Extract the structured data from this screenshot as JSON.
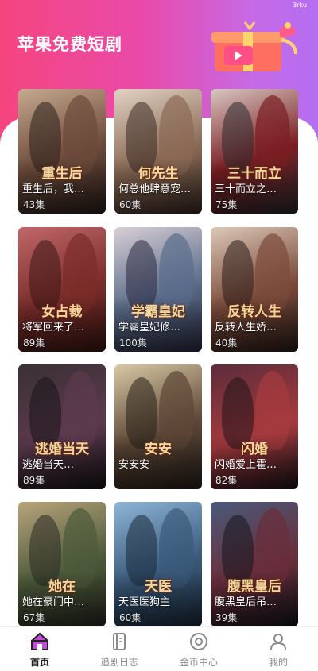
{
  "status": {
    "tag": "3rku"
  },
  "header": {
    "title": "苹果免费短剧"
  },
  "dramas": [
    {
      "deco": "重生后",
      "title": "重生后，我…",
      "episodes": "43集",
      "colors": [
        "#c7a98f",
        "#6b4a3a",
        "#2b1f1c"
      ]
    },
    {
      "deco": "何先生",
      "title": "何总他肆意宠…",
      "episodes": "60集",
      "colors": [
        "#e2d3c4",
        "#8a6a55",
        "#3a2a24"
      ]
    },
    {
      "deco": "三十而立",
      "title": "三十而立之…",
      "episodes": "75集",
      "colors": [
        "#d8c7c2",
        "#7a1e22",
        "#2c2a2e"
      ]
    },
    {
      "deco": "女占裁",
      "title": "将军回来了…",
      "episodes": "89集",
      "colors": [
        "#c0676a",
        "#7a2c2a",
        "#3b1814"
      ]
    },
    {
      "deco": "学霸皇妃",
      "title": "学霸皇妃修…",
      "episodes": "100集",
      "colors": [
        "#d9cfd6",
        "#5a6c8a",
        "#2a2a40"
      ]
    },
    {
      "deco": "反转人生",
      "title": "反转人生娇…",
      "episodes": "40集",
      "colors": [
        "#dcc8b8",
        "#7a4a3a",
        "#2c1e1a"
      ]
    },
    {
      "deco": "逃婚当天",
      "title": "逃婚当天…",
      "episodes": "89集",
      "colors": [
        "#3a3034",
        "#5c3a4e",
        "#1a1418"
      ]
    },
    {
      "deco": "安安",
      "title": "安安安",
      "episodes": "",
      "colors": [
        "#d9c9a4",
        "#5c4636",
        "#28201a"
      ]
    },
    {
      "deco": "闪婚",
      "title": "闪婚爱上霍…",
      "episodes": "82集",
      "colors": [
        "#5b2c3a",
        "#a53a3e",
        "#20141a"
      ]
    },
    {
      "deco": "她在",
      "title": "她在豪门中…",
      "episodes": "67集",
      "colors": [
        "#b8a47c",
        "#4c5a3a",
        "#2a2a22"
      ]
    },
    {
      "deco": "天医",
      "title": "天医医狗主",
      "episodes": "60集",
      "colors": [
        "#8fb5d6",
        "#3a5a7a",
        "#1a2a3a"
      ]
    },
    {
      "deco": "腹黑皇后",
      "title": "腹黑皇后吊…",
      "episodes": "39集",
      "colors": [
        "#4a5a7a",
        "#6a2e3a",
        "#14161e"
      ]
    }
  ],
  "tabs": [
    {
      "label": "首页",
      "icon": "home-icon",
      "active": true
    },
    {
      "label": "追剧日志",
      "icon": "book-icon",
      "active": false
    },
    {
      "label": "金币中心",
      "icon": "coin-icon",
      "active": false
    },
    {
      "label": "我的",
      "icon": "user-icon",
      "active": false
    }
  ],
  "colors": {
    "accent": "#e94aa9",
    "brand_start": "#f5457f",
    "brand_end": "#b46ef2"
  }
}
